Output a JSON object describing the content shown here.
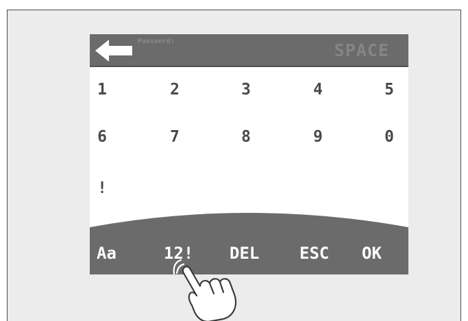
{
  "header": {
    "password_label": "Password:",
    "space_label": "SPACE",
    "back_icon": "left-arrow-icon"
  },
  "keypad": {
    "row1": [
      "1",
      "2",
      "3",
      "4",
      "5"
    ],
    "row2": [
      "6",
      "7",
      "8",
      "9",
      "0"
    ],
    "row3": [
      "!"
    ]
  },
  "bottom_bar": {
    "case_label": "Aa",
    "numeric_label": "12!",
    "delete_label": "DEL",
    "escape_label": "ESC",
    "ok_label": "OK"
  },
  "pointer": {
    "icon": "pointing-hand-icon"
  },
  "colors": {
    "bar": "#6b6b6b",
    "text": "#4a4a4a",
    "background": "#ececec"
  }
}
